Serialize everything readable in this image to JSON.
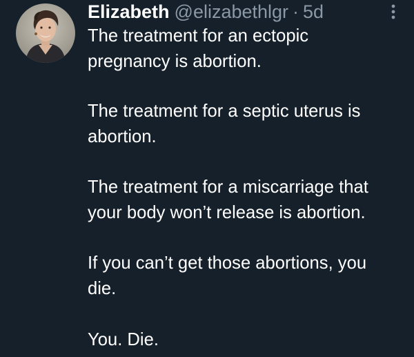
{
  "tweet": {
    "author": {
      "display_name": "Elizabeth",
      "handle": "@elizabethlgr",
      "separator": "·",
      "time": "5d",
      "avatar_icon": "user-avatar"
    },
    "more_icon": "more-options-icon",
    "paragraphs": [
      {
        "lines": [
          "The treatment for an ectopic",
          "pregnancy is abortion."
        ]
      },
      {
        "lines": [
          "The treatment for a septic uterus is",
          "abortion."
        ]
      },
      {
        "lines": [
          "The treatment for a miscarriage that",
          "your body won’t release is abortion."
        ]
      },
      {
        "lines": [
          "If you can’t get those abortions, you",
          "die."
        ]
      },
      {
        "lines": [
          "You. Die."
        ]
      }
    ]
  },
  "colors": {
    "background": "#15202b",
    "text_primary": "#ffffff",
    "text_secondary": "#8b98a5"
  }
}
